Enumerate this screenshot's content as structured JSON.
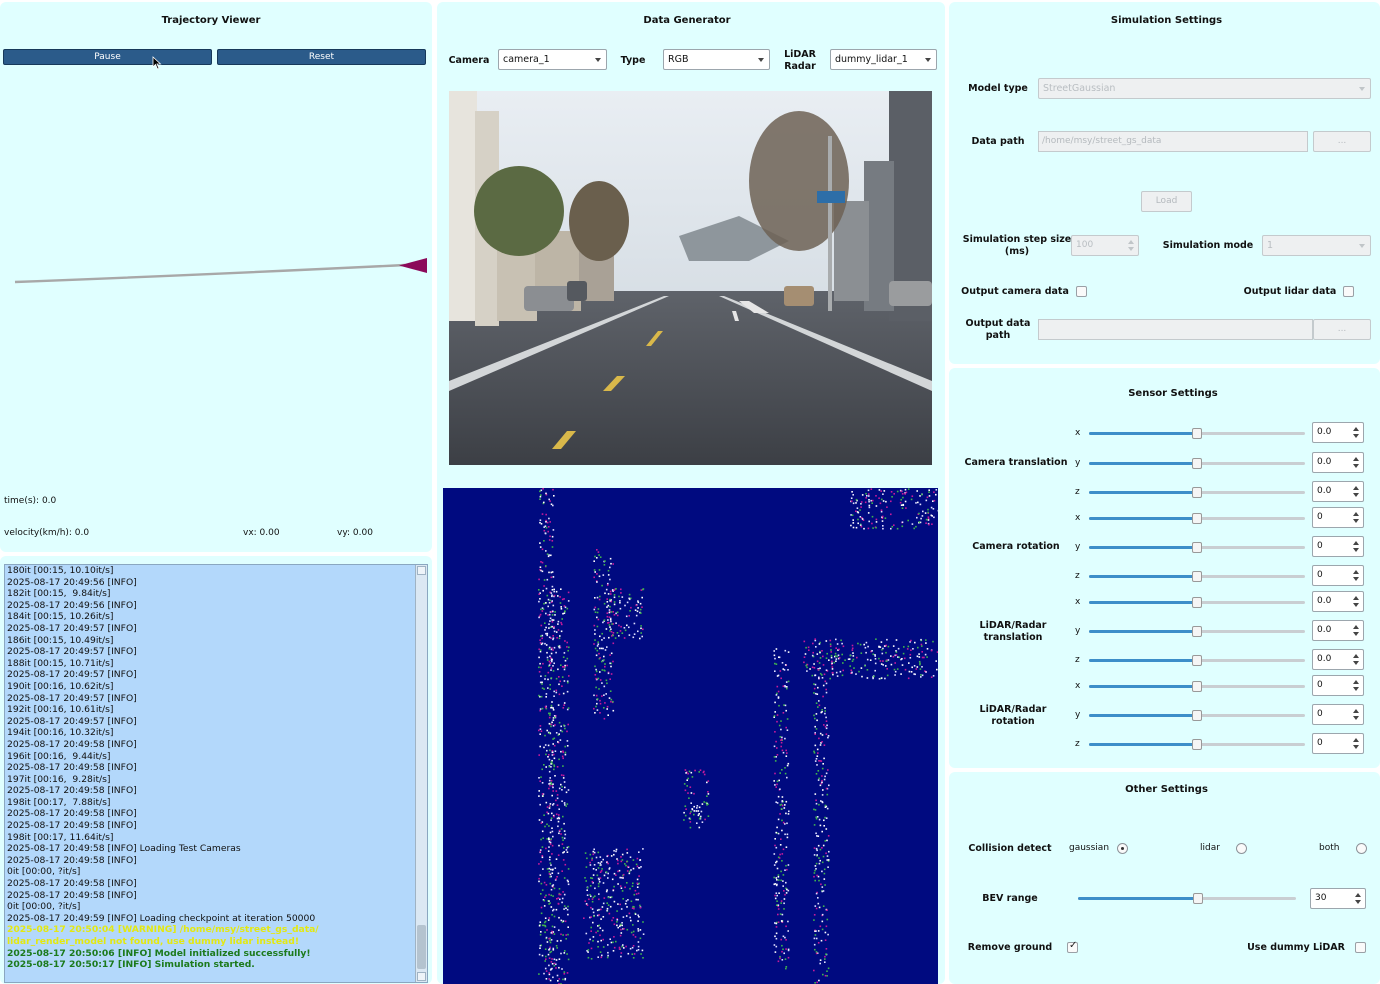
{
  "trajectory_viewer": {
    "title": "Trajectory Viewer",
    "pause_label": "Pause",
    "reset_label": "Reset",
    "time_text": "time(s): 0.0",
    "velocity_text": "velocity(km/h): 0.0",
    "vx_text": "vx: 0.00",
    "vy_text": "vy: 0.00",
    "path_color": "#a8a8a8",
    "vehicle_color": "#8b0a5a"
  },
  "log": {
    "lines": [
      {
        "text": "180it [00:15, 10.10it/s]",
        "level": "info"
      },
      {
        "text": "2025-08-17 20:49:56 [INFO]",
        "level": "info"
      },
      {
        "text": "182it [00:15,  9.84it/s]",
        "level": "info"
      },
      {
        "text": "2025-08-17 20:49:56 [INFO]",
        "level": "info"
      },
      {
        "text": "184it [00:15, 10.26it/s]",
        "level": "info"
      },
      {
        "text": "2025-08-17 20:49:57 [INFO]",
        "level": "info"
      },
      {
        "text": "186it [00:15, 10.49it/s]",
        "level": "info"
      },
      {
        "text": "2025-08-17 20:49:57 [INFO]",
        "level": "info"
      },
      {
        "text": "188it [00:15, 10.71it/s]",
        "level": "info"
      },
      {
        "text": "2025-08-17 20:49:57 [INFO]",
        "level": "info"
      },
      {
        "text": "190it [00:16, 10.62it/s]",
        "level": "info"
      },
      {
        "text": "2025-08-17 20:49:57 [INFO]",
        "level": "info"
      },
      {
        "text": "192it [00:16, 10.61it/s]",
        "level": "info"
      },
      {
        "text": "2025-08-17 20:49:57 [INFO]",
        "level": "info"
      },
      {
        "text": "194it [00:16, 10.32it/s]",
        "level": "info"
      },
      {
        "text": "2025-08-17 20:49:58 [INFO]",
        "level": "info"
      },
      {
        "text": "196it [00:16,  9.44it/s]",
        "level": "info"
      },
      {
        "text": "2025-08-17 20:49:58 [INFO]",
        "level": "info"
      },
      {
        "text": "197it [00:16,  9.28it/s]",
        "level": "info"
      },
      {
        "text": "2025-08-17 20:49:58 [INFO]",
        "level": "info"
      },
      {
        "text": "198it [00:17,  7.88it/s]",
        "level": "info"
      },
      {
        "text": "2025-08-17 20:49:58 [INFO]",
        "level": "info"
      },
      {
        "text": "2025-08-17 20:49:58 [INFO]",
        "level": "info"
      },
      {
        "text": "198it [00:17, 11.64it/s]",
        "level": "info"
      },
      {
        "text": "2025-08-17 20:49:58 [INFO] Loading Test Cameras",
        "level": "info"
      },
      {
        "text": "2025-08-17 20:49:58 [INFO]",
        "level": "info"
      },
      {
        "text": "0it [00:00, ?it/s]",
        "level": "info"
      },
      {
        "text": "2025-08-17 20:49:58 [INFO]",
        "level": "info"
      },
      {
        "text": "2025-08-17 20:49:58 [INFO]",
        "level": "info"
      },
      {
        "text": "0it [00:00, ?it/s]",
        "level": "info"
      },
      {
        "text": "2025-08-17 20:49:59 [INFO] Loading checkpoint at iteration 50000",
        "level": "info"
      },
      {
        "text": "2025-08-17 20:50:04 [WARNING] /home/msy/street_gs_data/",
        "level": "warn"
      },
      {
        "text": "lidar_render_model not found, use dummy lidar instead!",
        "level": "warn"
      },
      {
        "text": "2025-08-17 20:50:06 [INFO] Model initialized successfully!",
        "level": "ok"
      },
      {
        "text": "2025-08-17 20:50:17 [INFO] Simulation started.",
        "level": "ok"
      }
    ]
  },
  "data_generator": {
    "title": "Data Generator",
    "camera_label": "Camera",
    "camera_value": "camera_1",
    "type_label": "Type",
    "type_value": "RGB",
    "lidar_label": "LiDAR Radar",
    "lidar_value": "dummy_lidar_1",
    "bev_background": "#000a80"
  },
  "simulation_settings": {
    "title": "Simulation Settings",
    "model_type_label": "Model type",
    "model_type_value": "StreetGaussian",
    "data_path_label": "Data path",
    "data_path_value": "/home/msy/street_gs_data",
    "browse_label": "...",
    "load_label": "Load",
    "step_size_label": "Simulation step size (ms)",
    "step_size_value": "100",
    "mode_label": "Simulation mode",
    "mode_value": "1",
    "output_camera_label": "Output camera data",
    "output_lidar_label": "Output lidar data",
    "output_path_label": "Output data path",
    "output_path_value": "",
    "output_browse_label": "..."
  },
  "sensor_settings": {
    "title": "Sensor Settings",
    "groups": [
      {
        "label": "Camera translation",
        "axes": [
          {
            "axis": "x",
            "value": "0.0",
            "level": 0.5
          },
          {
            "axis": "y",
            "value": "0.0",
            "level": 0.5
          },
          {
            "axis": "z",
            "value": "0.0",
            "level": 0.5
          }
        ]
      },
      {
        "label": "Camera rotation",
        "axes": [
          {
            "axis": "x",
            "value": "0",
            "level": 0.5
          },
          {
            "axis": "y",
            "value": "0",
            "level": 0.5
          },
          {
            "axis": "z",
            "value": "0",
            "level": 0.5
          }
        ]
      },
      {
        "label": "LiDAR/Radar translation",
        "axes": [
          {
            "axis": "x",
            "value": "0.0",
            "level": 0.5
          },
          {
            "axis": "y",
            "value": "0.0",
            "level": 0.5
          },
          {
            "axis": "z",
            "value": "0.0",
            "level": 0.5
          }
        ]
      },
      {
        "label": "LiDAR/Radar rotation",
        "axes": [
          {
            "axis": "x",
            "value": "0",
            "level": 0.5
          },
          {
            "axis": "y",
            "value": "0",
            "level": 0.5
          },
          {
            "axis": "z",
            "value": "0",
            "level": 0.5
          }
        ]
      }
    ]
  },
  "other_settings": {
    "title": "Other Settings",
    "collision_label": "Collision detect",
    "collision_options": [
      "gaussian",
      "lidar",
      "both"
    ],
    "collision_selected": "gaussian",
    "bev_range_label": "BEV range",
    "bev_range_value": "30",
    "bev_range_level": 0.55,
    "remove_ground_label": "Remove ground",
    "remove_ground_checked": true,
    "dummy_lidar_label": "Use dummy LiDAR",
    "dummy_lidar_checked": false
  },
  "colors": {
    "panel_bg": "#e0ffff",
    "button_blue": "#2b5b8a",
    "log_bg": "#b3d8fb",
    "slider_fill": "#3d8ec9",
    "warning_text": "#e3e812",
    "success_text": "#1c7a1c"
  }
}
